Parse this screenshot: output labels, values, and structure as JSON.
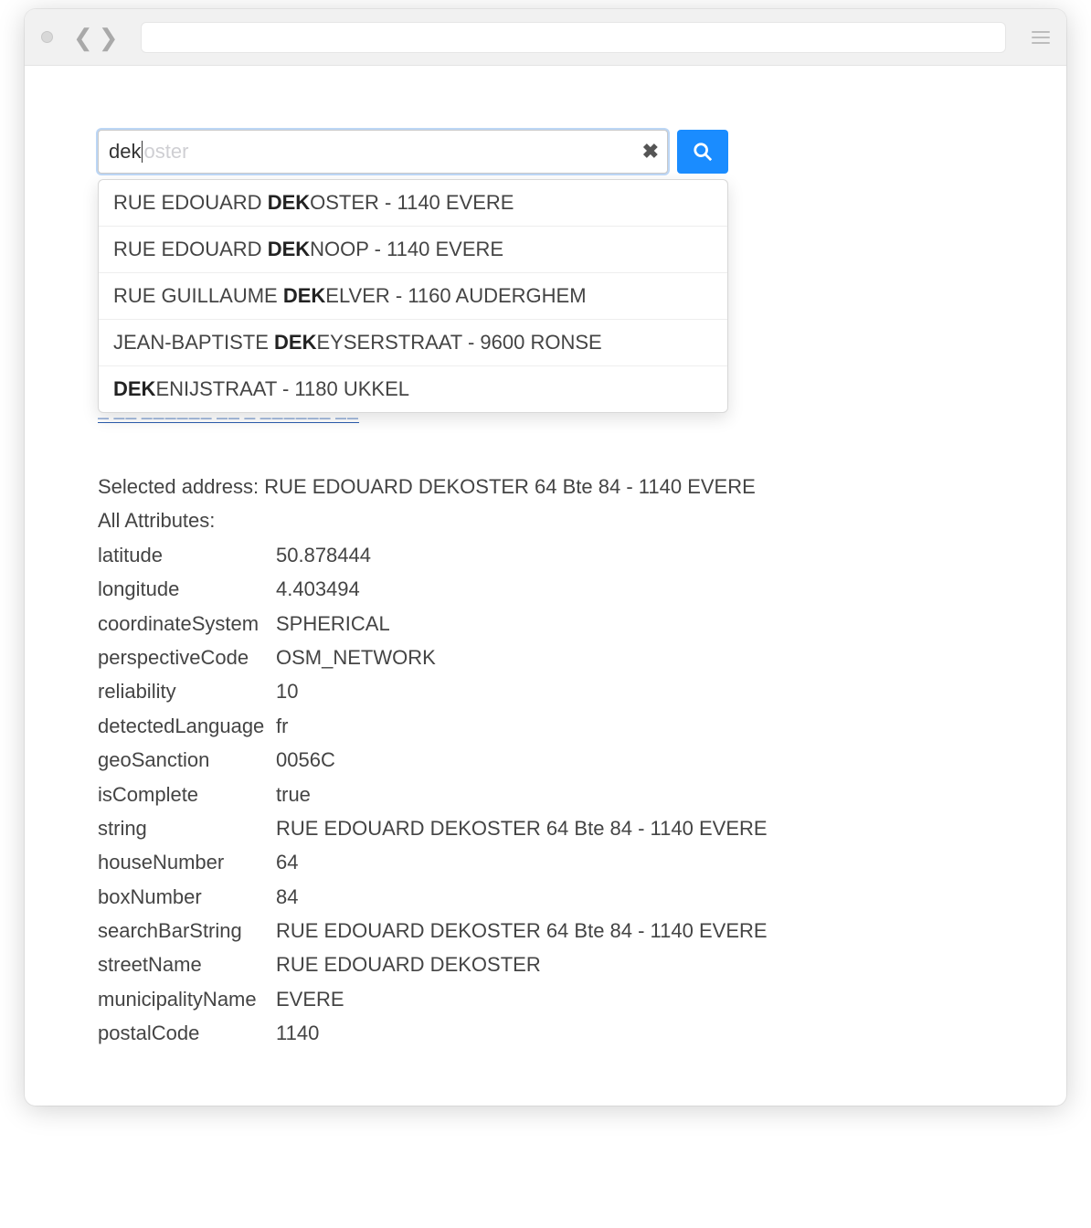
{
  "search": {
    "typed": "dek",
    "ghost_suffix": "oster"
  },
  "suggestions": [
    {
      "pre": "RUE EDOUARD ",
      "bold": "DEK",
      "post": "OSTER - 1140 EVERE"
    },
    {
      "pre": "RUE EDOUARD ",
      "bold": "DEK",
      "post": "NOOP - 1140 EVERE"
    },
    {
      "pre": "RUE GUILLAUME ",
      "bold": "DEK",
      "post": "ELVER - 1160 AUDERGHEM"
    },
    {
      "pre": "JEAN-BAPTISTE ",
      "bold": "DEK",
      "post": "EYSERSTRAAT - 9600 RONSE"
    },
    {
      "pre": "",
      "bold": "DEK",
      "post": "ENIJSTRAAT - 1180 UKKEL"
    }
  ],
  "selected": {
    "label": "Selected address:",
    "value": "RUE EDOUARD DEKOSTER 64 Bte 84 - 1140 EVERE"
  },
  "all_attributes_label": "All Attributes:",
  "attributes": [
    {
      "key": "latitude",
      "value": "50.878444"
    },
    {
      "key": "longitude",
      "value": "4.403494"
    },
    {
      "key": "coordinateSystem",
      "value": "SPHERICAL"
    },
    {
      "key": "perspectiveCode",
      "value": "OSM_NETWORK"
    },
    {
      "key": "reliability",
      "value": "10"
    },
    {
      "key": "detectedLanguage",
      "value": "fr"
    },
    {
      "key": "geoSanction",
      "value": "0056C"
    },
    {
      "key": "isComplete",
      "value": "true"
    },
    {
      "key": "string",
      "value": "RUE EDOUARD DEKOSTER 64 Bte 84 - 1140 EVERE"
    },
    {
      "key": "houseNumber",
      "value": "64"
    },
    {
      "key": "boxNumber",
      "value": "84"
    },
    {
      "key": "searchBarString",
      "value": "RUE EDOUARD DEKOSTER 64 Bte 84 - 1140 EVERE"
    },
    {
      "key": "streetName",
      "value": "RUE EDOUARD DEKOSTER"
    },
    {
      "key": "municipalityName",
      "value": "EVERE"
    },
    {
      "key": "postalCode",
      "value": "1140"
    }
  ]
}
